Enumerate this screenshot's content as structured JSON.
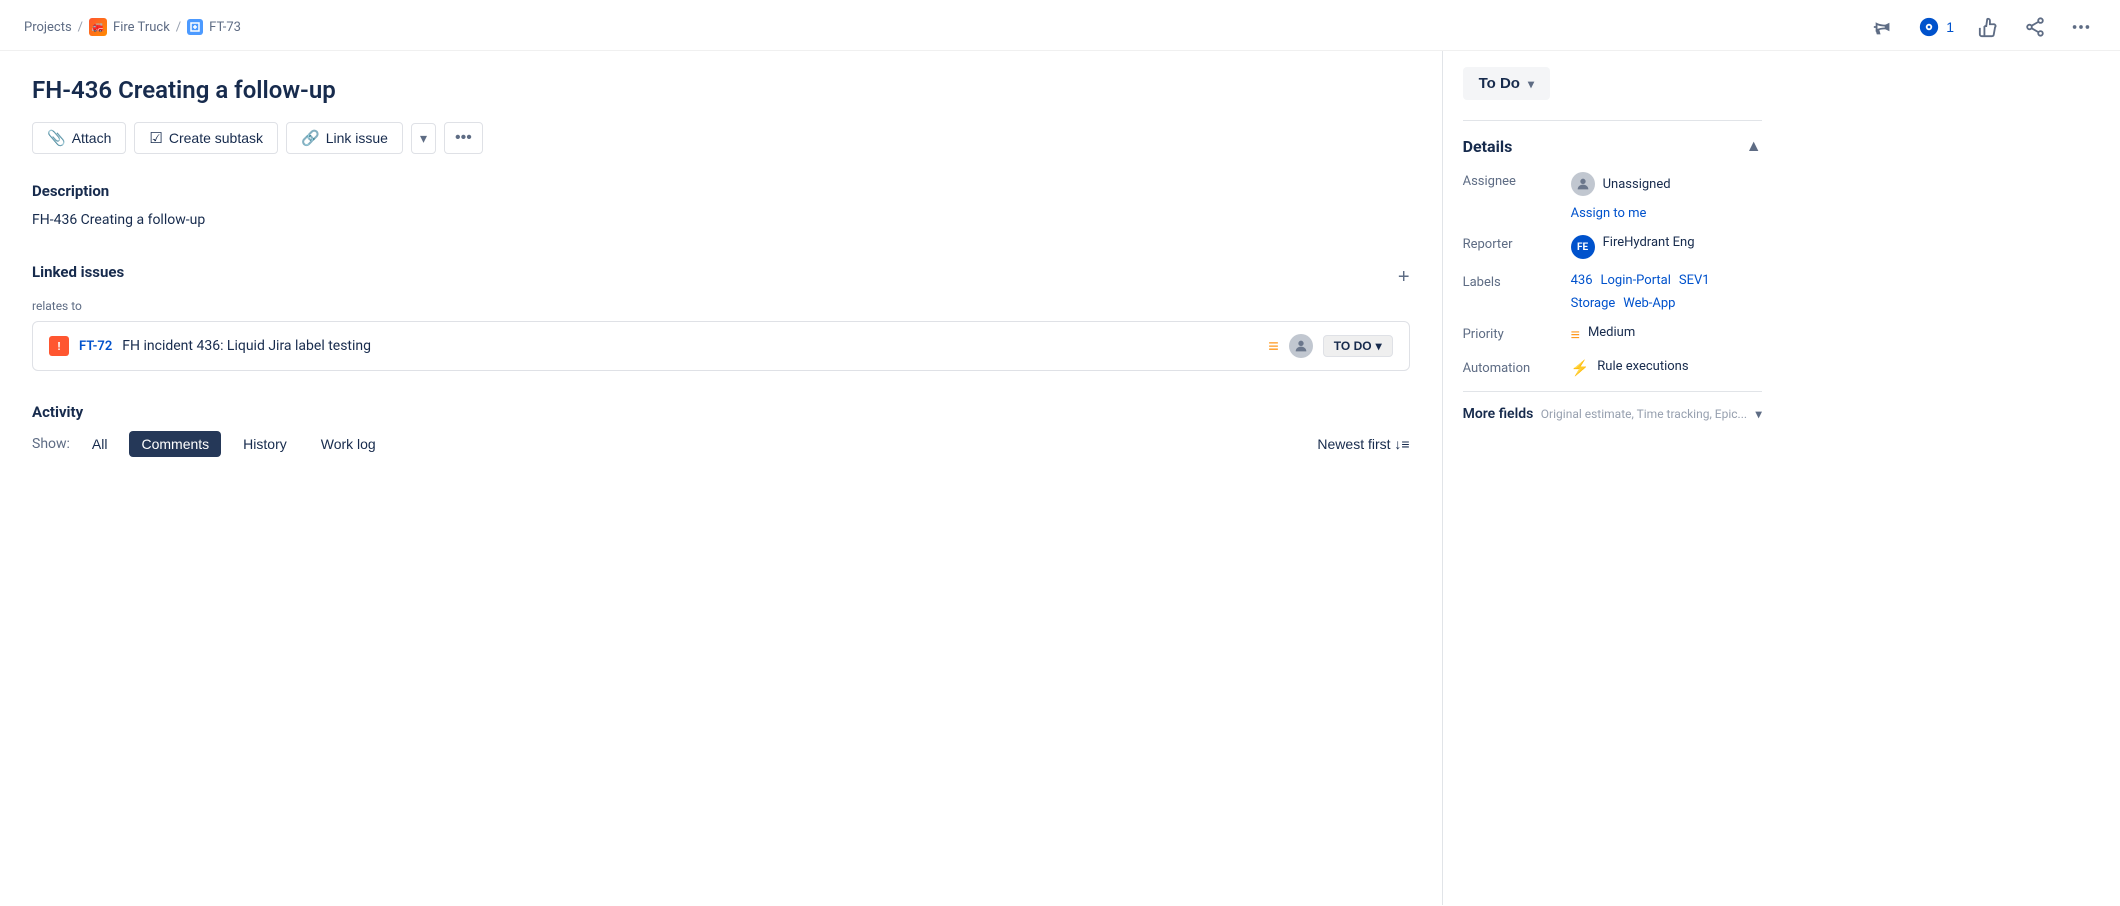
{
  "breadcrumb": {
    "projects_label": "Projects",
    "project_name": "Fire Truck",
    "issue_key": "FT-73"
  },
  "top_actions": {
    "watch_count": "1",
    "watch_label": "1"
  },
  "issue": {
    "title": "FH-436 Creating a follow-up",
    "description": "FH-436 Creating a follow-up"
  },
  "action_bar": {
    "attach_label": "Attach",
    "create_subtask_label": "Create subtask",
    "link_issue_label": "Link issue"
  },
  "linked_issues": {
    "section_title": "Linked issues",
    "relates_to": "relates to",
    "issue_key": "FT-72",
    "issue_summary": "FH incident 436: Liquid Jira label testing",
    "issue_status": "TO DO"
  },
  "activity": {
    "section_title": "Activity",
    "show_label": "Show:",
    "all_label": "All",
    "comments_label": "Comments",
    "history_label": "History",
    "worklog_label": "Work log",
    "newest_first_label": "Newest first"
  },
  "right_panel": {
    "status_label": "To Do",
    "details_label": "Details",
    "assignee_label": "Assignee",
    "assignee_value": "Unassigned",
    "assign_to_me": "Assign to me",
    "reporter_label": "Reporter",
    "reporter_name": "FireHydrant Eng",
    "reporter_initials": "FE",
    "labels_label": "Labels",
    "label_1": "436",
    "label_2": "Login-Portal",
    "label_3": "SEV1",
    "label_4": "Storage",
    "label_5": "Web-App",
    "priority_label": "Priority",
    "priority_value": "Medium",
    "automation_label": "Automation",
    "automation_value": "Rule executions",
    "more_fields_label": "More fields",
    "more_fields_hint": "Original estimate, Time tracking, Epic..."
  }
}
